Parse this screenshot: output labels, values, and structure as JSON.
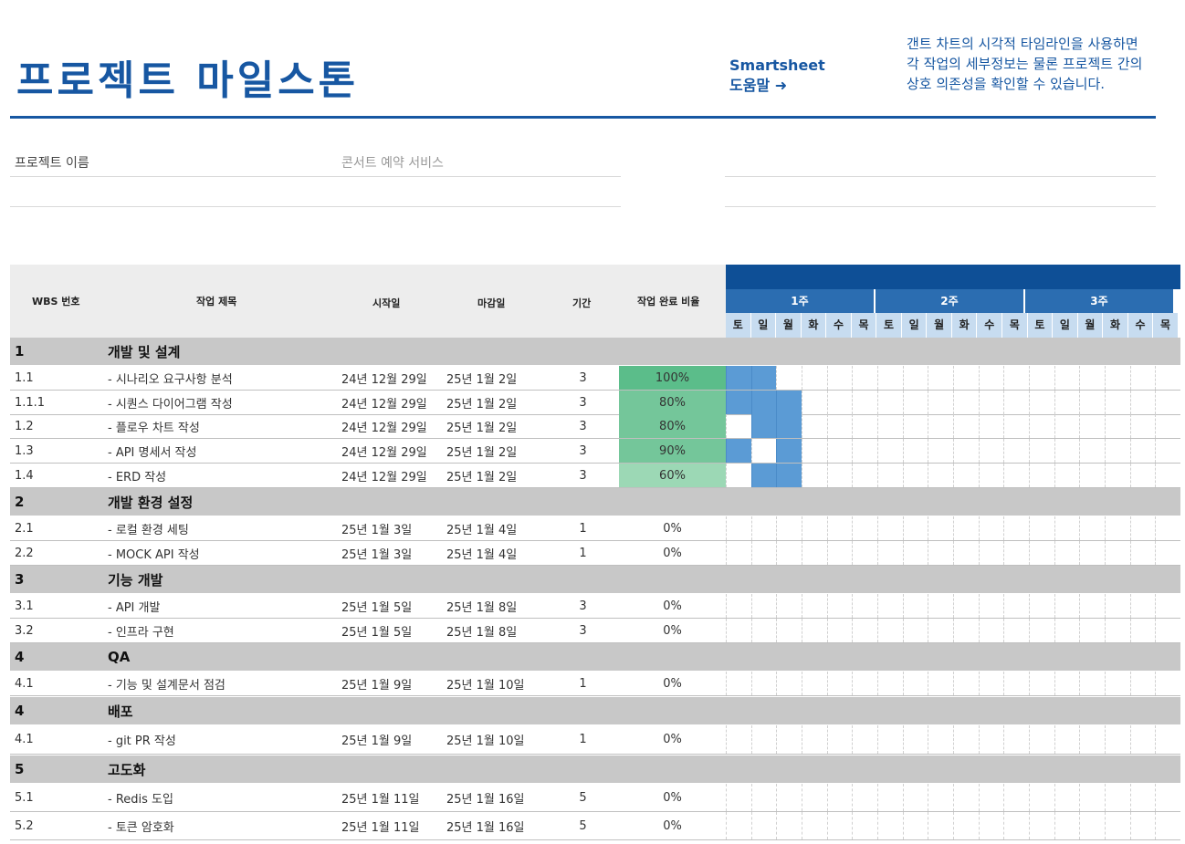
{
  "header": {
    "title": "프로젝트 마일스톤",
    "smartsheet_label": "Smartsheet",
    "help_label": "도움말",
    "help_arrow": "➜",
    "description": "갠트 차트의 시각적 타임라인을 사용하면 각 작업의 세부정보는 물론 프로젝트 간의 상호 의존성을 확인할 수 있습니다."
  },
  "project": {
    "name_label": "프로젝트 이름",
    "name_value": "콘서트 예약 서비스"
  },
  "columns": {
    "wbs": "WBS 번호",
    "task": "작업 제목",
    "start": "시작일",
    "end": "마감일",
    "duration": "기간",
    "complete": "작업 완료 비율"
  },
  "weeks": [
    "1주",
    "2주",
    "3주"
  ],
  "days": [
    "토",
    "일",
    "월",
    "화",
    "수",
    "목",
    "토",
    "일",
    "월",
    "화",
    "수",
    "목",
    "토",
    "일",
    "월",
    "화",
    "수",
    "목"
  ],
  "colors": {
    "brand_blue": "#1757a2",
    "gantt_dark": "#0e4f96",
    "week_blue": "#2b6db1",
    "day_blue": "#c7dcf0",
    "bar_blue": "#5b9bd5",
    "pct_dark": "#5bbd8a",
    "pct_mid": "#74c69a",
    "pct_light": "#9cd8b5"
  },
  "rows": [
    {
      "type": "group",
      "wbs": "1",
      "title": "개발 및 설계"
    },
    {
      "type": "task",
      "wbs": "1.1",
      "title": "- 시나리오 요구사항 분석",
      "start": "24년 12월 29일",
      "end": "25년 1월 2일",
      "duration": "3",
      "complete": "100%",
      "complete_value": 1.0,
      "bars": [
        0,
        1
      ]
    },
    {
      "type": "task",
      "wbs": "1.1.1",
      "title": "- 시퀀스 다이어그램 작성",
      "start": "24년 12월 29일",
      "end": "25년 1월 2일",
      "duration": "3",
      "complete": "80%",
      "complete_value": 0.8,
      "bars": [
        0,
        1,
        2
      ]
    },
    {
      "type": "task",
      "wbs": "1.2",
      "title": "- 플로우 차트 작성",
      "start": "24년 12월 29일",
      "end": "25년 1월 2일",
      "duration": "3",
      "complete": "80%",
      "complete_value": 0.8,
      "bars": [
        1,
        2
      ]
    },
    {
      "type": "task",
      "wbs": "1.3",
      "title": "- API 명세서 작성",
      "start": "24년 12월 29일",
      "end": "25년 1월 2일",
      "duration": "3",
      "complete": "90%",
      "complete_value": 0.9,
      "bars": [
        0,
        2
      ]
    },
    {
      "type": "task",
      "wbs": "1.4",
      "title": "- ERD 작성",
      "start": "24년 12월 29일",
      "end": "25년 1월 2일",
      "duration": "3",
      "complete": "60%",
      "complete_value": 0.6,
      "bars": [
        1,
        2
      ]
    },
    {
      "type": "group",
      "wbs": "2",
      "title": "개발 환경 설정"
    },
    {
      "type": "task",
      "wbs": "2.1",
      "title": "- 로컬 환경 세팅",
      "start": "25년 1월 3일",
      "end": "25년 1월 4일",
      "duration": "1",
      "complete": "0%",
      "complete_value": 0,
      "bars": []
    },
    {
      "type": "task",
      "wbs": "2.2",
      "title": "- MOCK API 작성",
      "start": "25년 1월 3일",
      "end": "25년 1월 4일",
      "duration": "1",
      "complete": "0%",
      "complete_value": 0,
      "bars": []
    },
    {
      "type": "group",
      "wbs": "3",
      "title": "기능 개발"
    },
    {
      "type": "task",
      "wbs": "3.1",
      "title": "- API 개발",
      "start": "25년 1월 5일",
      "end": "25년 1월 8일",
      "duration": "3",
      "complete": "0%",
      "complete_value": 0,
      "bars": []
    },
    {
      "type": "task",
      "wbs": "3.2",
      "title": "- 인프라 구현",
      "start": "25년 1월 5일",
      "end": "25년 1월 8일",
      "duration": "3",
      "complete": "0%",
      "complete_value": 0,
      "bars": []
    },
    {
      "type": "group",
      "wbs": "4",
      "title": "QA"
    },
    {
      "type": "task",
      "wbs": "4.1",
      "title": "- 기능 및 설계문서 점검",
      "start": "25년 1월 9일",
      "end": "25년 1월 10일",
      "duration": "1",
      "complete": "0%",
      "complete_value": 0,
      "bars": []
    },
    {
      "type": "group",
      "wbs": "4",
      "title": "배포"
    },
    {
      "type": "task",
      "wbs": "4.1",
      "title": "- git PR 작성",
      "start": "25년 1월 9일",
      "end": "25년 1월 10일",
      "duration": "1",
      "complete": "0%",
      "complete_value": 0,
      "bars": []
    },
    {
      "type": "group",
      "wbs": "5",
      "title": "고도화"
    },
    {
      "type": "task",
      "wbs": "5.1",
      "title": "- Redis 도입",
      "start": "25년 1월 11일",
      "end": "25년 1월 16일",
      "duration": "5",
      "complete": "0%",
      "complete_value": 0,
      "bars": []
    },
    {
      "type": "task",
      "wbs": "5.2",
      "title": "- 토큰 암호화",
      "start": "25년 1월 11일",
      "end": "25년 1월 16일",
      "duration": "5",
      "complete": "0%",
      "complete_value": 0,
      "bars": []
    }
  ]
}
